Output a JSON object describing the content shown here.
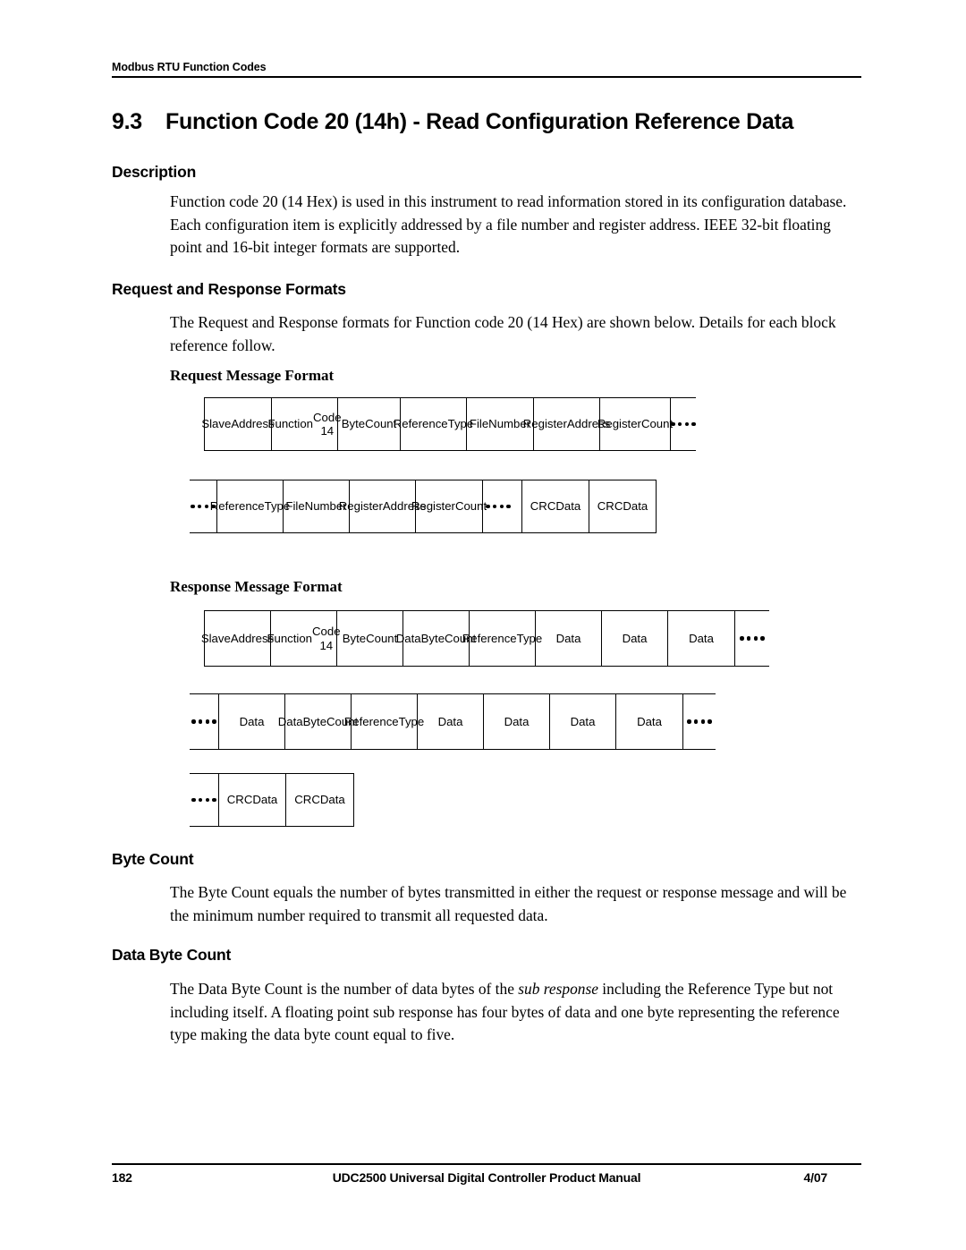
{
  "header": {
    "running_title": "Modbus RTU Function Codes"
  },
  "title": {
    "number": "9.3",
    "text": "Function Code 20 (14h) - Read Configuration Reference Data"
  },
  "sections": {
    "description": {
      "heading": "Description",
      "body": "Function code 20 (14 Hex) is used in this instrument to read information stored in its configuration database. Each  configuration item is explicitly addressed by a file number and register address. IEEE 32-bit floating point and 16-bit integer formats are supported."
    },
    "formats": {
      "heading": "Request and Response Formats",
      "body": "The Request and Response formats for Function code 20 (14 Hex) are shown below. Details for each block reference follow.",
      "request_heading": "Request Message Format",
      "response_heading": "Response Message Format"
    },
    "byte_count": {
      "heading": "Byte Count",
      "body": "The Byte Count equals the number of bytes transmitted in either the request or response message and will be the minimum number required to transmit all requested data."
    },
    "data_byte_count": {
      "heading": "Data Byte Count",
      "body_part1": "The Data Byte Count is the number of data bytes of the ",
      "body_italic": "sub response",
      "body_part2": " including the Reference Type but not including itself. A floating point sub response has four bytes of data and one byte representing the reference type making the data byte count equal to five."
    }
  },
  "request_message": {
    "row1": {
      "cells": [
        "Slave\nAddress",
        "Function\nCode 14",
        "Byte\nCount",
        "Reference\nType",
        "File\nNumber",
        "Register\nAddress",
        "Register\nCount"
      ],
      "trailing_dots": "...."
    },
    "row2": {
      "leading_dots": "....",
      "cells": [
        "Reference\nType",
        "File\nNumber",
        "Register\nAddress",
        "Register\nCount"
      ],
      "middle_dots": "....",
      "crc_cells": [
        "CRC\nData",
        "CRC\nData"
      ]
    }
  },
  "response_message": {
    "row1": {
      "cells": [
        "Slave\nAddress",
        "Function\nCode 14",
        "Byte\nCount",
        "Data\nByte\nCount",
        "Reference\nType",
        "Data",
        "Data",
        "Data"
      ],
      "trailing_dots": "...."
    },
    "row2": {
      "leading_dots": "....",
      "cells": [
        "Data",
        "Data\nByte\nCount",
        "Reference\nType",
        "Data",
        "Data",
        "Data",
        "Data"
      ],
      "trailing_dots": "...."
    },
    "row3": {
      "leading_dots": "....",
      "cells": [
        "CRC\nData",
        "CRC\nData"
      ]
    }
  },
  "footer": {
    "page_number": "182",
    "manual_title": "UDC2500 Universal Digital Controller Product Manual",
    "date": "4/07"
  }
}
